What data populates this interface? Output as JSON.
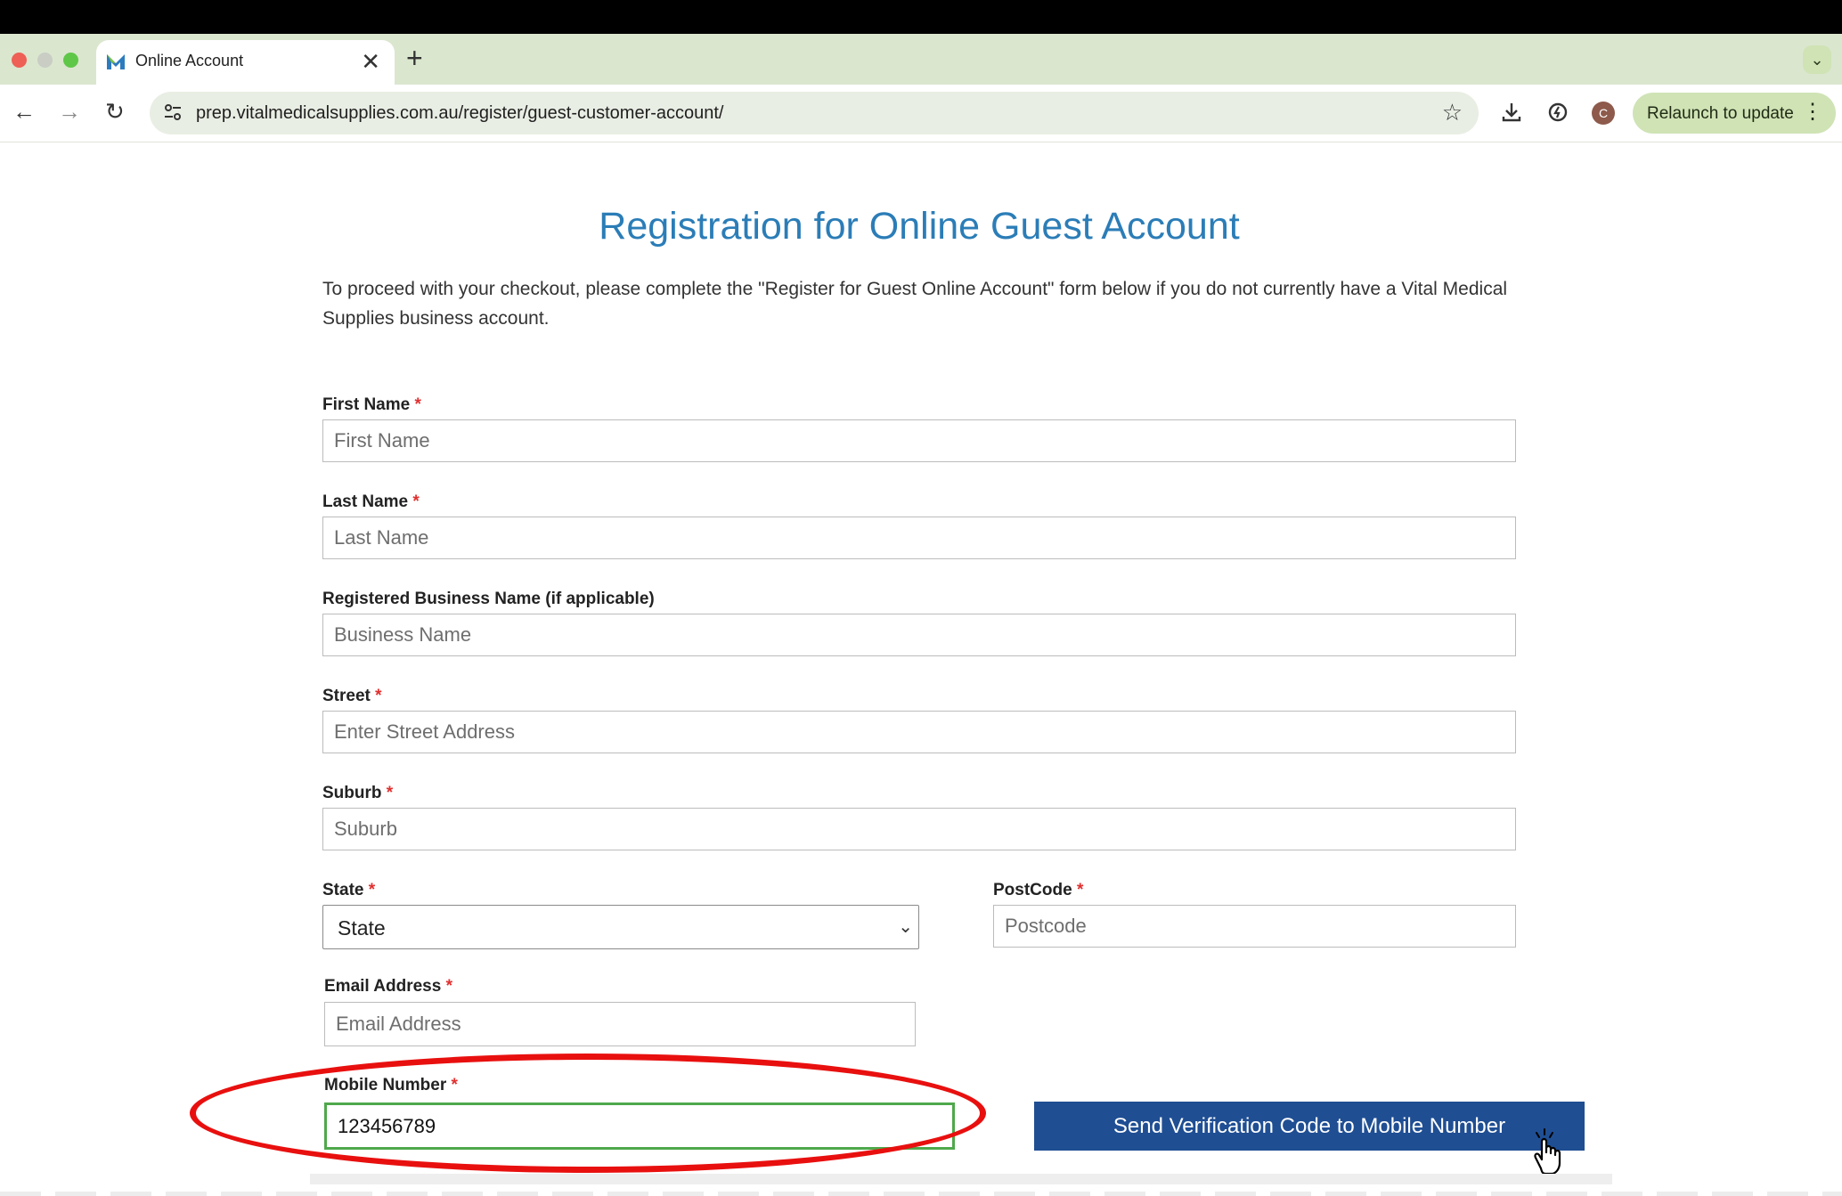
{
  "browser": {
    "tab_title": "Online Account",
    "close_glyph": "✕",
    "new_tab_glyph": "+",
    "tab_menu_glyph": "⌄",
    "url": "prep.vitalmedicalsupplies.com.au/register/guest-customer-account/",
    "star_glyph": "☆",
    "nav": {
      "back": "←",
      "forward": "→",
      "reload": "↻"
    },
    "avatar_letter": "C",
    "relaunch_label": "Relaunch to update",
    "menu_glyph": "⋮"
  },
  "page": {
    "heading": "Registration for Online Guest Account",
    "intro": "To proceed with your checkout, please complete the \"Register for Guest Online Account\" form below if you do not currently have a Vital Medical Supplies business account.",
    "required_mark": "*"
  },
  "form": {
    "first_name": {
      "label": "First Name",
      "placeholder": "First Name",
      "value": ""
    },
    "last_name": {
      "label": "Last Name",
      "placeholder": "Last Name",
      "value": ""
    },
    "business_name": {
      "label": "Registered Business Name (if applicable)",
      "placeholder": "Business Name",
      "value": ""
    },
    "street": {
      "label": "Street",
      "placeholder": "Enter Street Address",
      "value": ""
    },
    "suburb": {
      "label": "Suburb",
      "placeholder": "Suburb",
      "value": ""
    },
    "state": {
      "label": "State",
      "selected": "State",
      "chevron": "⌄"
    },
    "postcode": {
      "label": "PostCode",
      "placeholder": "Postcode",
      "value": ""
    },
    "email": {
      "label": "Email Address",
      "placeholder": "Email Address",
      "value": ""
    },
    "mobile": {
      "label": "Mobile Number",
      "placeholder": "",
      "value": "123456789"
    },
    "send_button": "Send Verification Code to Mobile Number"
  },
  "colors": {
    "heading": "#2b7db7",
    "button": "#1f4e93",
    "required": "#e0302f",
    "annotation_oval": "#e8100f",
    "active_field_border": "#4fa84b",
    "tabstrip": "#dbe6cf"
  },
  "icons": [
    "site-favicon-icon",
    "tune-icon",
    "bookmark-star-icon",
    "download-icon",
    "extensions-icon",
    "hand-pointer-icon"
  ]
}
